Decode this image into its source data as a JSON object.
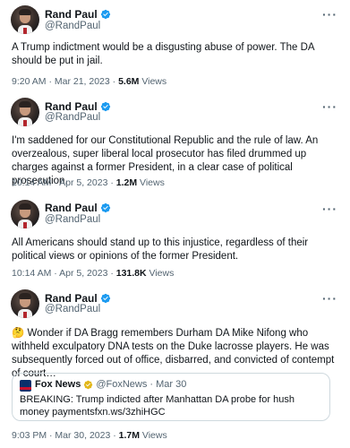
{
  "tweets": [
    {
      "author": "Rand Paul",
      "handle": "@RandPaul",
      "text": "A Trump indictment would be a disgusting abuse of power. The DA should be put in jail.",
      "timestamp": "9:20 AM · Mar 21, 2023 · ",
      "views_count": "5.6M",
      "views_label": " Views"
    },
    {
      "author": "Rand Paul",
      "handle": "@RandPaul",
      "text": "I'm saddened for our Constitutional Republic and the rule of law. An overzealous, super liberal local prosecutor has filed drummed up charges against a former President, in a clear case of political prosecution.",
      "timestamp": "10:14 AM · Apr 5, 2023 · ",
      "views_count": "1.2M",
      "views_label": " Views"
    },
    {
      "author": "Rand Paul",
      "handle": "@RandPaul",
      "text": "All Americans should stand up to this injustice, regardless of their political views or opinions of the former President.",
      "timestamp": "10:14 AM · Apr 5, 2023 · ",
      "views_count": "131.8K",
      "views_label": " Views"
    },
    {
      "author": "Rand Paul",
      "handle": "@RandPaul",
      "emoji": "🤔",
      "text": " Wonder if DA Bragg remembers Durham DA Mike Nifong who withheld exculpatory DNA tests on the Duke lacrosse players. He was subsequently forced out of office, disbarred, and convicted of contempt of court…",
      "quote": {
        "author": "Fox News",
        "handle": "@FoxNews · Mar 30",
        "text": "BREAKING: Trump indicted after Manhattan DA probe for hush money paymentsfxn.ws/3zhiHGC"
      },
      "timestamp": "9:03 PM · Mar 30, 2023 · ",
      "views_count": "1.7M",
      "views_label": " Views"
    }
  ],
  "more_glyph": "···",
  "colors": {
    "verified_blue": "#1d9bf0",
    "verified_gold": "#e2b719",
    "secondary_text": "#536471",
    "border": "#cfd9de"
  },
  "icons": {
    "more": "more-options-icon",
    "verified": "verified-badge-icon",
    "gold_verified": "gold-verified-badge-icon"
  }
}
